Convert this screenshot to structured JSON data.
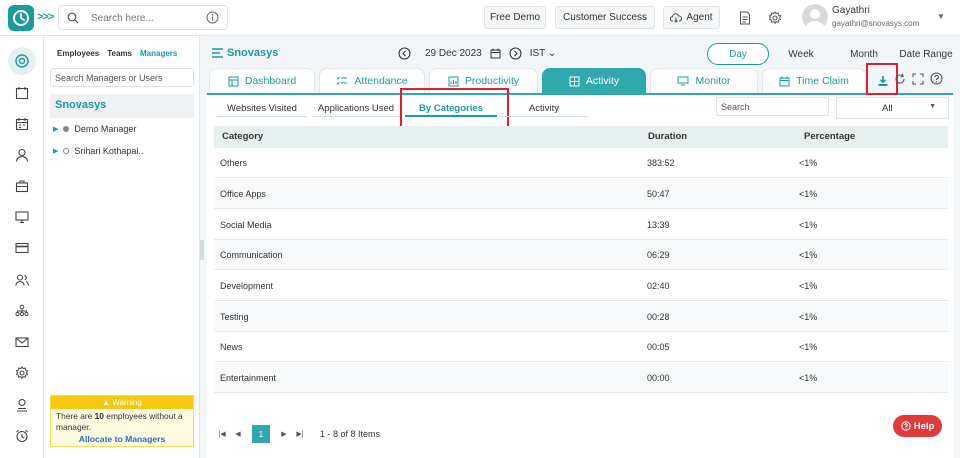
{
  "colors": {
    "accent": "#1a9b9f",
    "tab_active": "#2fa9ad",
    "highlight": "#e0202e",
    "warning": "#f6c90e",
    "help": "#e03b3b",
    "link": "#1f6fc4"
  },
  "topbar": {
    "search_placeholder": "Search here...",
    "buttons": [
      "Free Demo",
      "Customer Success",
      "Agent"
    ],
    "user": {
      "name": "Gayathri",
      "email": "gayathri@snovasys.com"
    }
  },
  "rail_icons": [
    "dashboard-icon",
    "calendar-icon",
    "calendar-grid-icon",
    "user-icon",
    "briefcase-icon",
    "monitor-icon",
    "card-icon",
    "users-icon",
    "org-chart-icon",
    "mail-icon",
    "settings-icon",
    "badge-icon",
    "alarm-icon"
  ],
  "left_panel": {
    "tabs": [
      "Employees",
      "Teams",
      "Managers"
    ],
    "active_tab": "Managers",
    "search_placeholder": "Search Managers or Users",
    "org": "Snovasys",
    "tree": [
      "Demo Manager",
      "Srihari Kothapal.."
    ],
    "warning": {
      "title": "Warning",
      "text_pre": "There are ",
      "count": "10",
      "text_post": " employees without a manager.",
      "link": "Allocate to Managers"
    }
  },
  "header": {
    "title": "Snovasys",
    "date": "29 Dec 2023",
    "timezone": "IST",
    "periods": [
      "Day",
      "Week",
      "Month",
      "Date Range"
    ],
    "active_period": "Day"
  },
  "module_tabs": [
    "Dashboard",
    "Attendance",
    "Productivity",
    "Activity",
    "Monitor",
    "Time Claim"
  ],
  "active_module": "Activity",
  "sub_tabs": [
    "Websites Visited",
    "Applications Used",
    "By Categories",
    "Activity"
  ],
  "active_sub_tab": "By Categories",
  "filters": {
    "search_placeholder": "Search",
    "select_value": "All"
  },
  "table": {
    "columns": [
      "Category",
      "Duration",
      "Percentage"
    ],
    "rows": [
      {
        "category": "Others",
        "duration": "383:52",
        "percentage": "<1%"
      },
      {
        "category": "Office Apps",
        "duration": "50:47",
        "percentage": "<1%"
      },
      {
        "category": "Social Media",
        "duration": "13:39",
        "percentage": "<1%"
      },
      {
        "category": "Communication",
        "duration": "06:29",
        "percentage": "<1%"
      },
      {
        "category": "Development",
        "duration": "02:40",
        "percentage": "<1%"
      },
      {
        "category": "Testing",
        "duration": "00:28",
        "percentage": "<1%"
      },
      {
        "category": "News",
        "duration": "00:05",
        "percentage": "<1%"
      },
      {
        "category": "Entertainment",
        "duration": "00:00",
        "percentage": "<1%"
      }
    ]
  },
  "pager": {
    "current_page": "1",
    "summary": "1 - 8 of 8 Items"
  },
  "help_label": "Help"
}
